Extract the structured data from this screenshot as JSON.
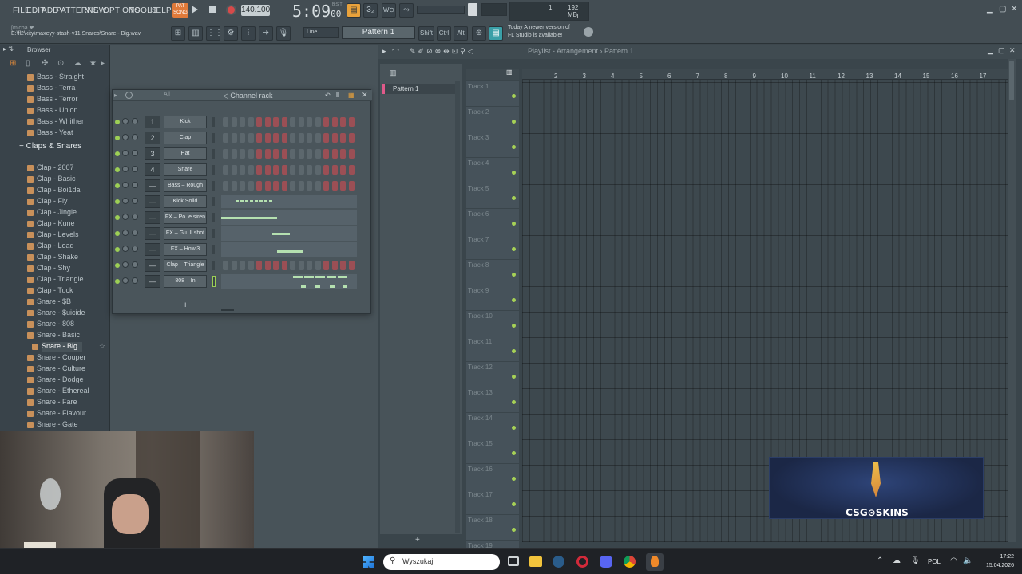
{
  "menu": [
    "FILE",
    "EDIT",
    "ADD",
    "PATTERNS",
    "VIEW",
    "OPTIONS",
    "TOOLS",
    "HELP"
  ],
  "transport": {
    "pat": "PAT",
    "song": "SONG",
    "bpm": "140.100",
    "time": "5:09",
    "time_small": "00",
    "bst": "B:S:T"
  },
  "status": {
    "hint": "[micha ❤",
    "path": "E:\\fl2\\kity\\maxeyy-stash-v11.Snares\\Snare - Big.wav"
  },
  "cpu": {
    "cpu": "1",
    "ram": "192 MB",
    "poly": "1"
  },
  "toolbar": {
    "snap": "Line",
    "pattern": "Pattern 1",
    "shift": "Shift",
    "ctrl": "Ctrl",
    "alt": "Alt"
  },
  "news": {
    "line1": "Today  A newer version of",
    "line2": "FL Studio is available!"
  },
  "browser": {
    "title": "Browser",
    "items_top": [
      "Bass - Straight",
      "Bass - Terra",
      "Bass - Terror",
      "Bass - Union",
      "Bass - Whither",
      "Bass - Yeat"
    ],
    "folder": "Claps & Snares",
    "items": [
      "Clap - 2007",
      "Clap - Basic",
      "Clap - Boi1da",
      "Clap - Fly",
      "Clap - Jingle",
      "Clap - Kune",
      "Clap - Levels",
      "Clap - Load",
      "Clap - Shake",
      "Clap - Shy",
      "Clap - Triangle",
      "Clap - Tuck",
      "Snare - $B",
      "Snare - $uicide",
      "Snare - 808",
      "Snare - Basic",
      "Snare - Big",
      "Snare - Couper",
      "Snare - Culture",
      "Snare - Dodge",
      "Snare - Ethereal",
      "Snare - Fare",
      "Snare - Flavour",
      "Snare - Gate"
    ],
    "selected": "Snare - Big"
  },
  "channel_rack": {
    "filter": "All",
    "title": "Channel rack",
    "channels": [
      {
        "num": "1",
        "name": "Kick"
      },
      {
        "num": "2",
        "name": "Clap"
      },
      {
        "num": "3",
        "name": "Hat"
      },
      {
        "num": "4",
        "name": "Snare"
      },
      {
        "num": "—",
        "name": "Bass – Rough"
      },
      {
        "num": "—",
        "name": "Kick Solid"
      },
      {
        "num": "—",
        "name": "FX – Po..e siren"
      },
      {
        "num": "—",
        "name": "FX – Gu..ll shot"
      },
      {
        "num": "—",
        "name": "FX – Howl3"
      },
      {
        "num": "—",
        "name": "Clap – Triangle"
      },
      {
        "num": "—",
        "name": "808 – In"
      }
    ],
    "add": "+"
  },
  "patterns": {
    "item": "Pattern 1"
  },
  "playlist": {
    "breadcrumb": "Playlist - Arrangement › Pattern 1",
    "bars": [
      "2",
      "3",
      "4",
      "5",
      "6",
      "7",
      "8",
      "9",
      "10",
      "11",
      "12",
      "13",
      "14",
      "15",
      "16",
      "17"
    ],
    "tracks": [
      "Track 1",
      "Track 2",
      "Track 3",
      "Track 4",
      "Track 5",
      "Track 6",
      "Track 7",
      "Track 8",
      "Track 9",
      "Track 10",
      "Track 11",
      "Track 12",
      "Track 13",
      "Track 14",
      "Track 15",
      "Track 16",
      "Track 17",
      "Track 18",
      "Track 19"
    ]
  },
  "ad": {
    "text": "CSG⊙SKINS"
  },
  "taskbar": {
    "search": "Wyszukaj",
    "lang": "POL",
    "time": "17:22",
    "date": "15.04.2026"
  }
}
